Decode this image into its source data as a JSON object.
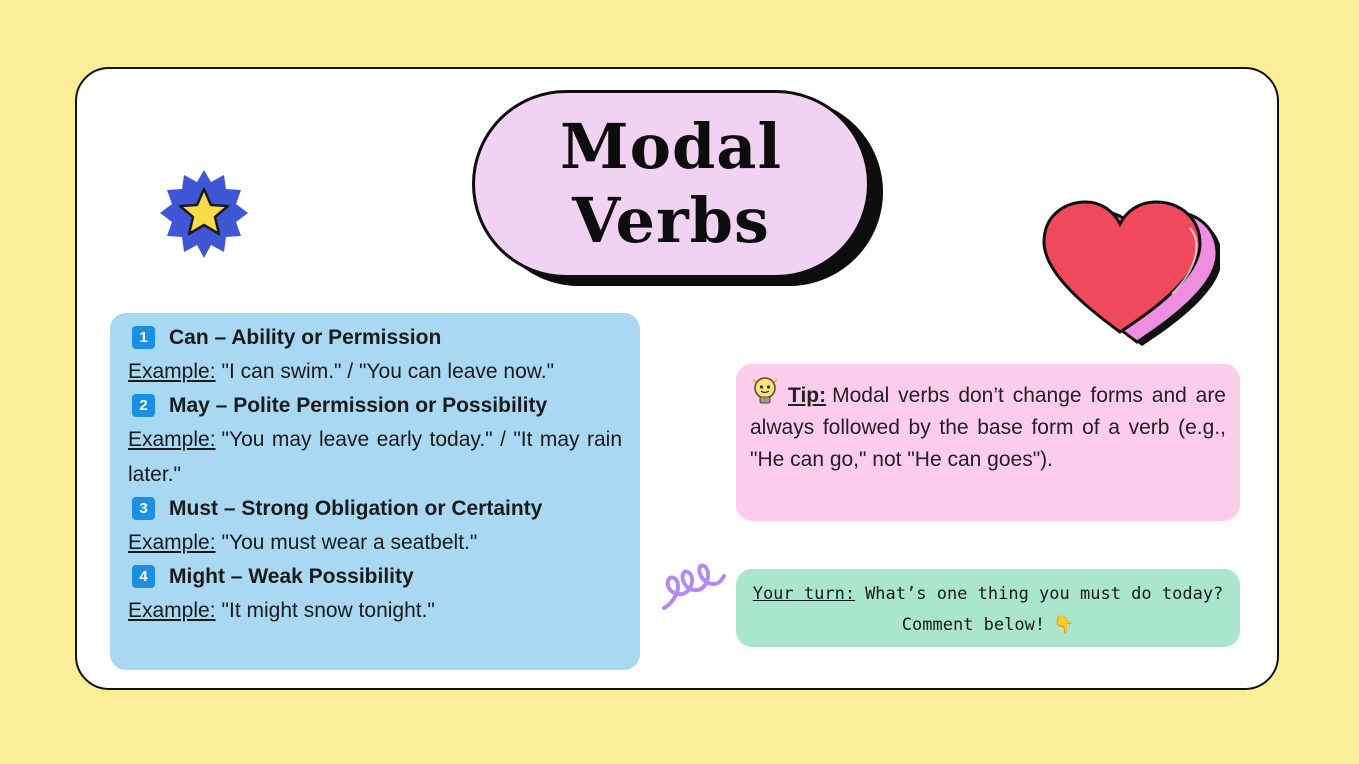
{
  "title": {
    "line1": "Modal",
    "line2": "Verbs"
  },
  "items": [
    {
      "num": "1",
      "heading": "Can – Ability or Permission",
      "example_label": "Example:",
      "example": "\"I can swim.\" / \"You can leave now.\""
    },
    {
      "num": "2",
      "heading": "May – Polite Permission or Possibility",
      "example_label": "Example:",
      "example": "\"You may leave early today.\" / \"It may rain later.\""
    },
    {
      "num": "3",
      "heading": "Must – Strong Obligation or Certainty",
      "example_label": "Example:",
      "example": "\"You must wear a seatbelt.\""
    },
    {
      "num": "4",
      "heading": "Might – Weak Possibility",
      "example_label": "Example:",
      "example": "\"It might snow tonight.\""
    }
  ],
  "tip": {
    "label": "Tip:",
    "text": "Modal verbs don’t change forms and are always followed by the base form of a verb (e.g., \"He can go,\" not \"He can goes\")."
  },
  "your_turn": {
    "label": "Your turn:",
    "text": "What’s one thing you must do today? Comment below!",
    "hand": "👇"
  },
  "colors": {
    "background": "#fcee98",
    "title_pill": "#f2d2f2",
    "list_box": "#a8d8f2",
    "tip_box": "#fecdee",
    "turn_box": "#a9e6cd",
    "number_badge": "#1d8fe0",
    "star_badge": "#3f57d4",
    "star": "#f7dc48",
    "heart": "#f0485c",
    "heart_edge": "#ee8ee0",
    "swirl": "#b58af0"
  },
  "icons": [
    "star-badge-icon",
    "heart-icon",
    "lightbulb-icon",
    "swirl-icon",
    "pointing-down-hand-icon"
  ]
}
